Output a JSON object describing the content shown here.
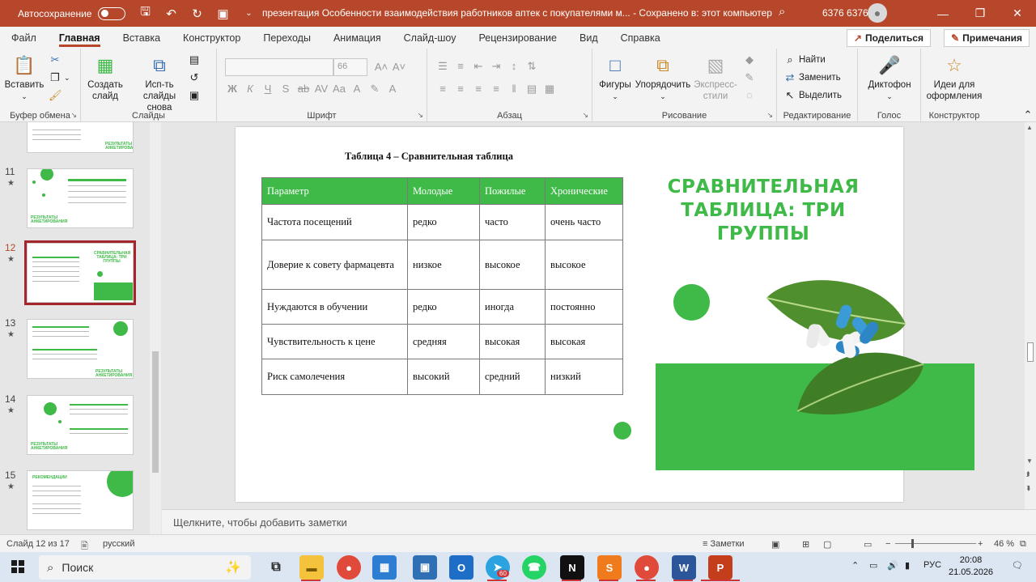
{
  "titlebar": {
    "autosave_label": "Автосохранение",
    "document_title": "презентация Особенности взаимодействия работников аптек с покупателями м...  -  Сохранено в: этот компьютер",
    "user_name": "6376 6376"
  },
  "menu": {
    "tabs": [
      "Файл",
      "Главная",
      "Вставка",
      "Конструктор",
      "Переходы",
      "Анимация",
      "Слайд-шоу",
      "Рецензирование",
      "Вид",
      "Справка"
    ],
    "active_tab": "Главная",
    "share_label": "Поделиться",
    "comments_label": "Примечания"
  },
  "ribbon": {
    "paste_label": "Вставить",
    "clipboard_group": "Буфер обмена",
    "new_slide_label": "Создать слайд",
    "reuse_slides_label": "Исп-ть слайды снова",
    "slides_group": "Слайды",
    "font_size": "66",
    "font_group": "Шрифт",
    "paragraph_group": "Абзац",
    "shapes_label": "Фигуры",
    "arrange_label": "Упорядочить",
    "quick_styles_label": "Экспресс-стили",
    "drawing_group": "Рисование",
    "find_label": "Найти",
    "replace_label": "Заменить",
    "select_label": "Выделить",
    "editing_group": "Редактирование",
    "dictate_label": "Диктофон",
    "voice_group": "Голос",
    "designer_label": "Идеи для оформления",
    "designer_group": "Конструктор"
  },
  "thumbnails": {
    "items": [
      {
        "number": "11",
        "star": "★"
      },
      {
        "number": "12",
        "star": "★"
      },
      {
        "number": "13",
        "star": "★"
      },
      {
        "number": "14",
        "star": "★"
      },
      {
        "number": "15",
        "star": "★"
      }
    ],
    "label_results": "РЕЗУЛЬТАТЫ АНКЕТИРОВАНИЯ",
    "label_recommend": "РЕКОМЕНДАЦИИ"
  },
  "slide": {
    "caption": "Таблица 4 – Сравнительная таблица",
    "title": "СРАВНИТЕЛЬНАЯ ТАБЛИЦА: ТРИ ГРУППЫ",
    "table": {
      "headers": [
        "Параметр",
        "Молодые",
        "Пожилые",
        "Хронические"
      ],
      "rows": [
        [
          "Частота посещений",
          "редко",
          "часто",
          "очень часто"
        ],
        [
          "Доверие к совету фармацевта",
          "низкое",
          "высокое",
          "высокое"
        ],
        [
          "Нуждаются в обучении",
          "редко",
          "иногда",
          "постоянно"
        ],
        [
          "Чувствительность к цене",
          "средняя",
          "высокая",
          "высокая"
        ],
        [
          "Риск самолечения",
          "высокий",
          "средний",
          "низкий"
        ]
      ]
    },
    "accent_color": "#3fb948"
  },
  "notes": {
    "placeholder": "Щелкните, чтобы добавить заметки"
  },
  "statusbar": {
    "slide_counter": "Слайд 12 из 17",
    "language": "русский",
    "notes_label": "Заметки",
    "zoom": "46 %"
  },
  "taskbar": {
    "search_label": "Поиск",
    "telegram_badge": "60",
    "lang": "РУС",
    "time": "20:08",
    "date": "21.05.2026"
  }
}
